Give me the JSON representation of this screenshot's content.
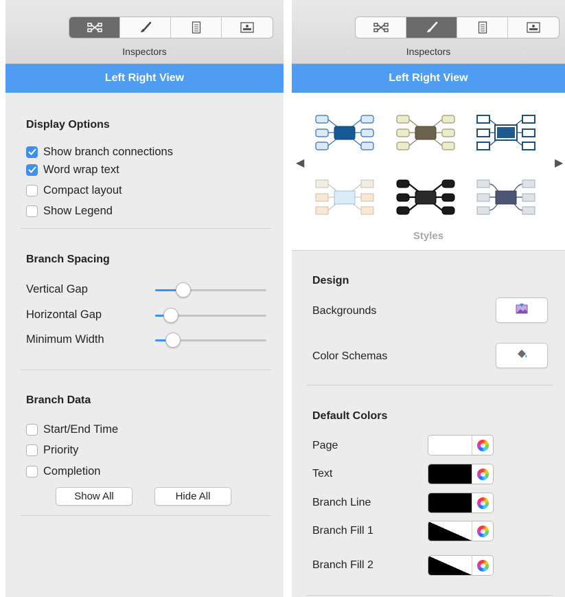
{
  "left": {
    "inspectors_label": "Inspectors",
    "view_title": "Left Right View",
    "tabs": [
      {
        "icon": "layout-icon",
        "active": true
      },
      {
        "icon": "brush-icon",
        "active": false
      },
      {
        "icon": "document-icon",
        "active": false
      },
      {
        "icon": "image-icon",
        "active": false
      }
    ],
    "display_options": {
      "title": "Display Options",
      "items": [
        {
          "label": "Show branch connections",
          "checked": true
        },
        {
          "label": "Word wrap text",
          "checked": true
        },
        {
          "label": "Compact layout",
          "checked": false
        },
        {
          "label": "Show Legend",
          "checked": false
        }
      ]
    },
    "branch_spacing": {
      "title": "Branch Spacing",
      "sliders": [
        {
          "label": "Vertical Gap",
          "value_fraction": 0.25
        },
        {
          "label": "Horizontal Gap",
          "value_fraction": 0.14
        },
        {
          "label": "Minimum Width",
          "value_fraction": 0.16
        }
      ]
    },
    "branch_data": {
      "title": "Branch Data",
      "items": [
        {
          "label": "Start/End Time",
          "checked": false
        },
        {
          "label": "Priority",
          "checked": false
        },
        {
          "label": "Completion",
          "checked": false
        }
      ],
      "show_all_label": "Show All",
      "hide_all_label": "Hide All"
    }
  },
  "right": {
    "inspectors_label": "Inspectors",
    "view_title": "Left Right View",
    "tabs": [
      {
        "icon": "layout-icon",
        "active": false
      },
      {
        "icon": "brush-icon",
        "active": true
      },
      {
        "icon": "document-icon",
        "active": false
      },
      {
        "icon": "image-icon",
        "active": false
      }
    ],
    "styles_label": "Styles",
    "design": {
      "title": "Design",
      "backgrounds_label": "Backgrounds",
      "color_schemas_label": "Color Schemas"
    },
    "default_colors": {
      "title": "Default Colors",
      "items": [
        {
          "label": "Page",
          "swatch": "#ffffff"
        },
        {
          "label": "Text",
          "swatch": "#000000"
        },
        {
          "label": "Branch Line",
          "swatch": "#000000"
        },
        {
          "label": "Branch Fill 1",
          "swatch": "split-black-white"
        },
        {
          "label": "Branch Fill 2",
          "swatch": "split-black-white"
        }
      ]
    }
  },
  "colors": {
    "accent": "#4e9df2",
    "checkbox_checked": "#3d8ff0",
    "panel_bg": "#ececec"
  }
}
